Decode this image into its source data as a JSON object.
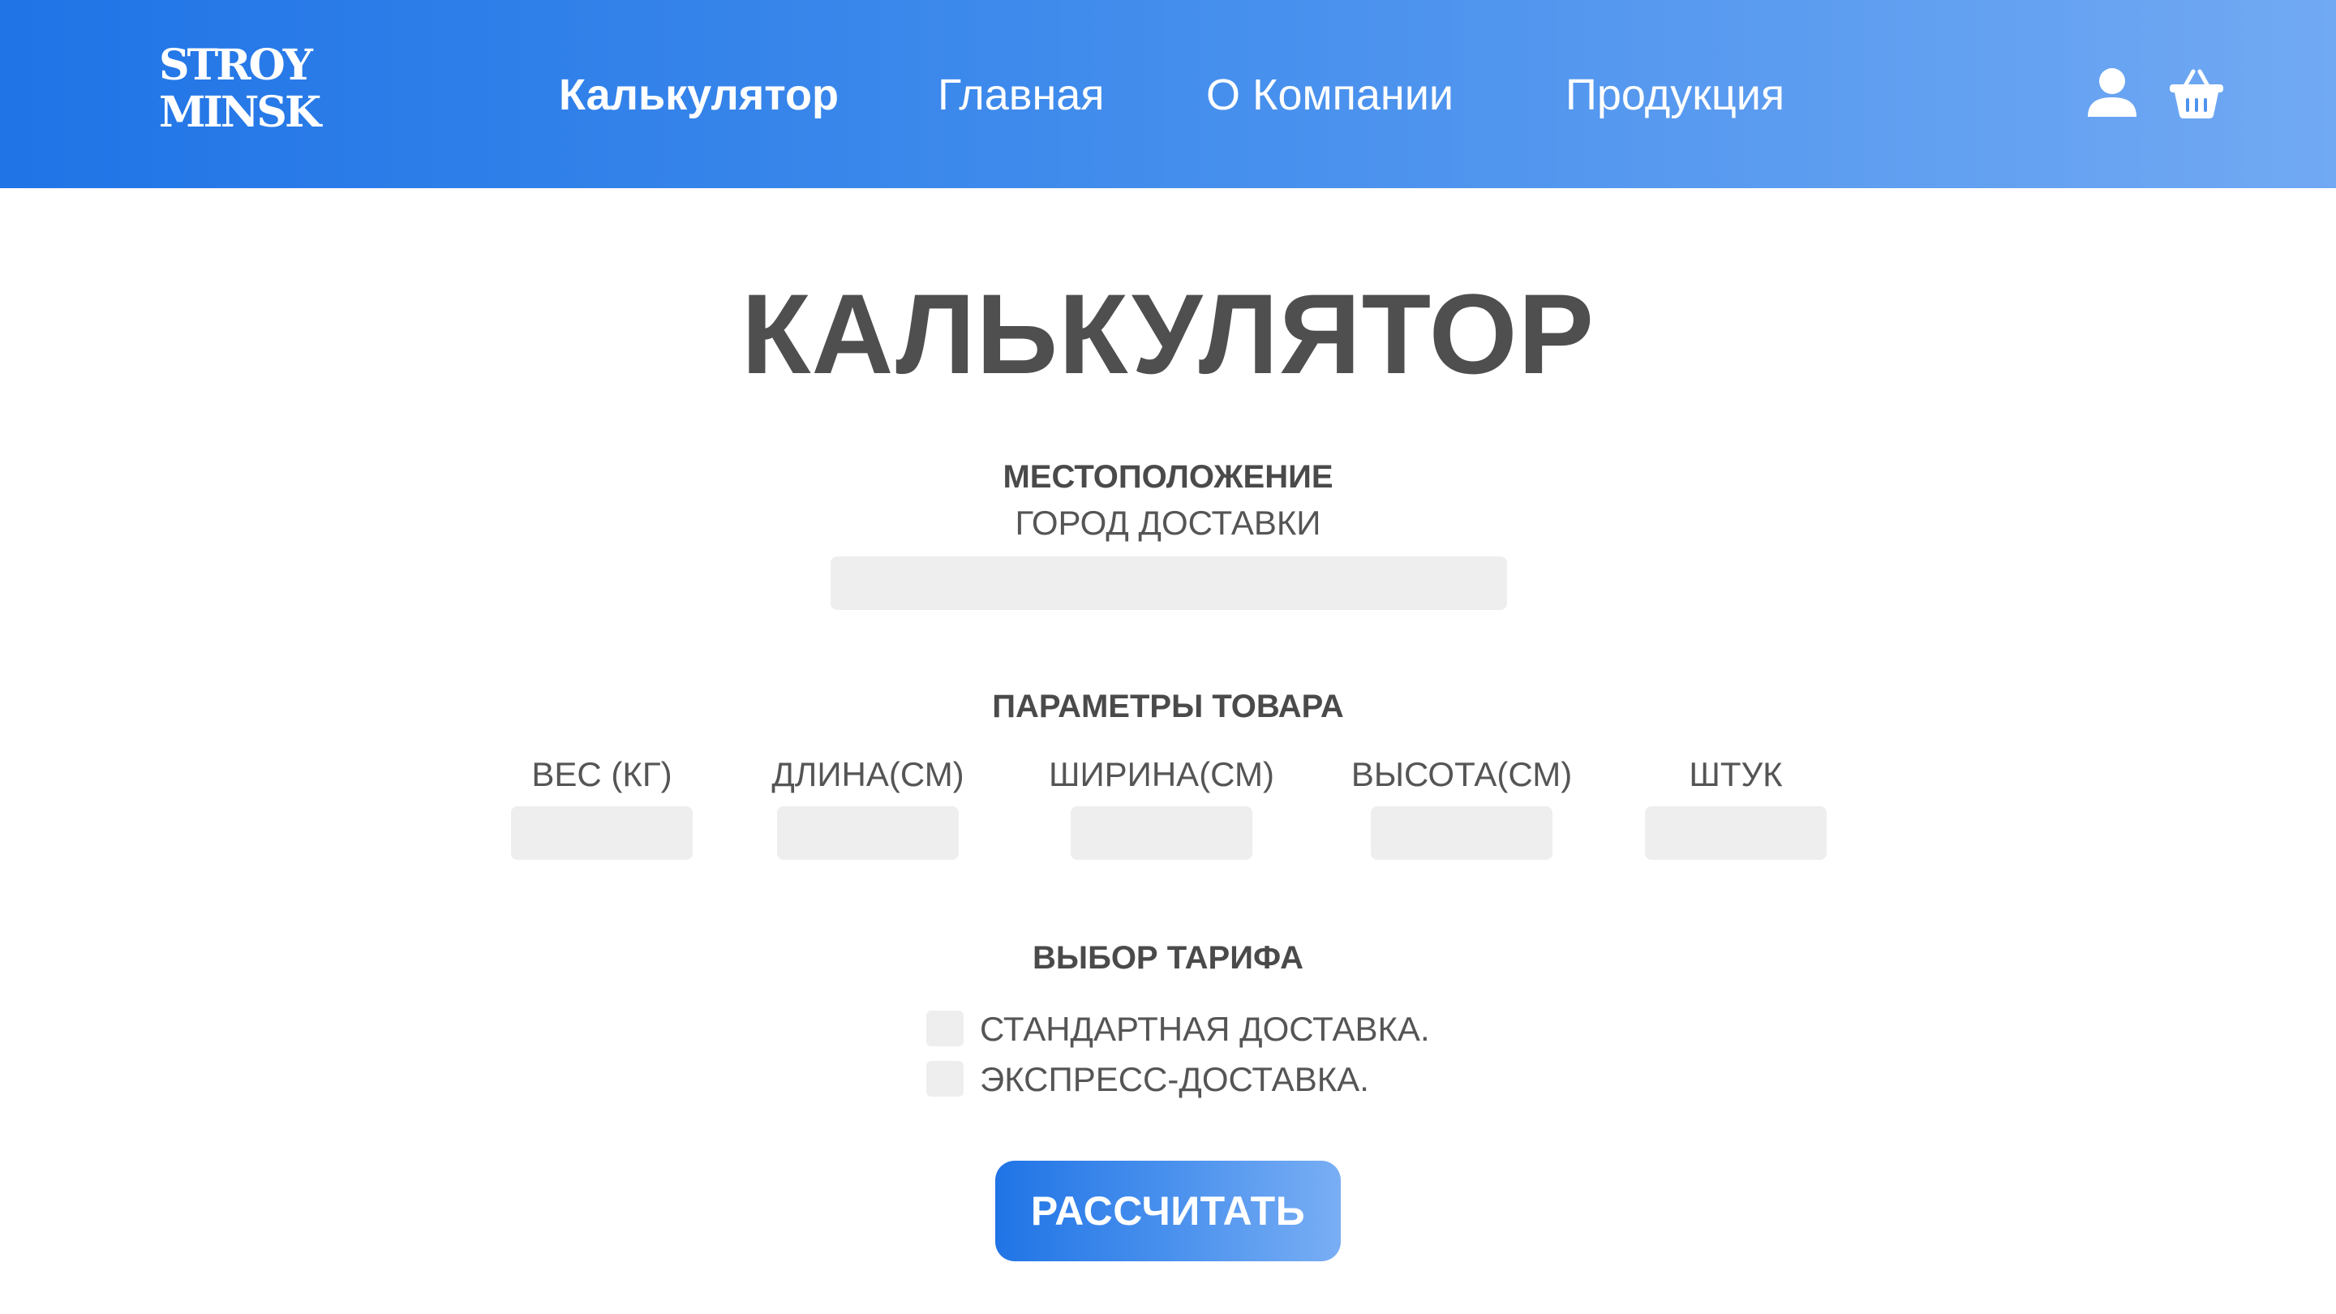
{
  "header": {
    "logo_line1": "STROY",
    "logo_line2": "MINSK",
    "nav": [
      {
        "label": "Калькулятор",
        "active": true
      },
      {
        "label": "Главная",
        "active": false
      },
      {
        "label": "О Компании",
        "active": false
      },
      {
        "label": "Продукция",
        "active": false
      }
    ],
    "icons": [
      "user-icon",
      "basket-icon"
    ],
    "gradient_colors": [
      "#2074e6",
      "#71a9f3"
    ]
  },
  "main": {
    "title": "КАЛЬКУЛЯТОР",
    "location": {
      "heading": "МЕСТОПОЛОЖЕНИЕ",
      "city_label": "ГОРОД ДОСТАВКИ",
      "city_value": ""
    },
    "params": {
      "heading": "ПАРАМЕТРЫ ТОВАРА",
      "fields": [
        {
          "label": "ВЕС (КГ)",
          "value": ""
        },
        {
          "label": "ДЛИНА(СМ)",
          "value": ""
        },
        {
          "label": "ШИРИНА(СМ)",
          "value": ""
        },
        {
          "label": "ВЫСОТА(СМ)",
          "value": ""
        },
        {
          "label": "ШТУК",
          "value": ""
        }
      ]
    },
    "tariff": {
      "heading": "ВЫБОР ТАРИФА",
      "options": [
        {
          "label": "СТАНДАРТНАЯ ДОСТАВКА.",
          "checked": false
        },
        {
          "label": "ЭКСПРЕСС-ДОСТАВКА.",
          "checked": false
        }
      ]
    },
    "button_label": "РАССЧИТАТЬ"
  },
  "colors": {
    "text_dark": "#4f4f4f",
    "field_bg": "#eeeeee",
    "accent": "#2074e6"
  }
}
